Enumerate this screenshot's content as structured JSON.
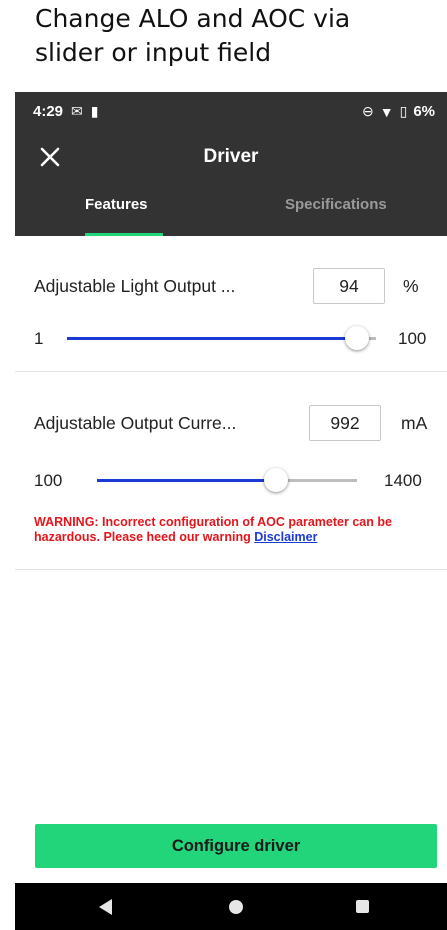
{
  "caption": "Change ALO and AOC via\nslider or input field",
  "status_bar": {
    "time": "4:29",
    "battery": "6%"
  },
  "app_bar": {
    "title": "Driver"
  },
  "tabs": [
    {
      "label": "Features",
      "active": true
    },
    {
      "label": "Specifications",
      "active": false
    }
  ],
  "alo": {
    "label": "Adjustable Light Output ...",
    "value": "94",
    "unit": "%",
    "min_label": "1",
    "max_label": "100",
    "slider_fraction": 0.94
  },
  "aoc": {
    "label": "Adjustable Output Curre...",
    "value": "992",
    "unit": "mA",
    "min_label": "100",
    "max_label": "1400",
    "slider_fraction": 0.69
  },
  "warning": {
    "text": "WARNING: Incorrect configuration of AOC parameter can be hazardous. Please heed our warning ",
    "link": "Disclaimer"
  },
  "configure_button": "Configure driver",
  "colors": {
    "accent_green": "#22d47a",
    "slider_blue": "#1a3ad6",
    "warning_red": "#e4151b",
    "header_dark": "#333333"
  }
}
